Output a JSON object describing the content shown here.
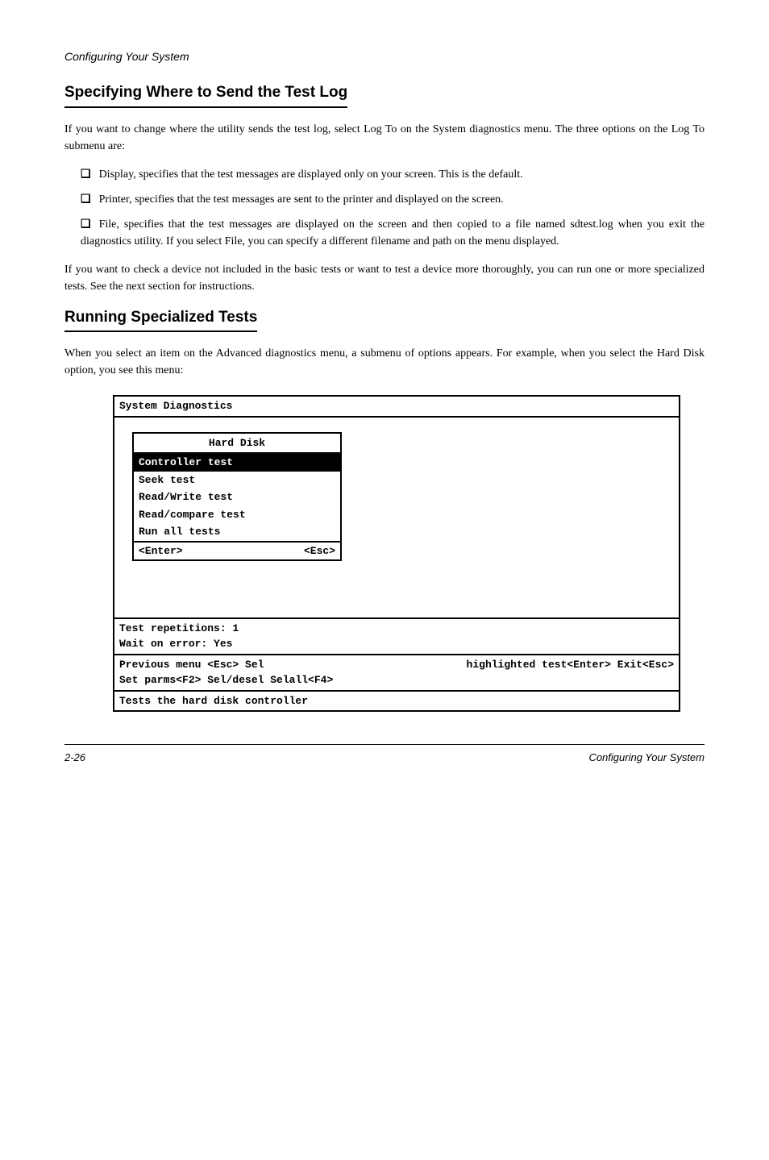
{
  "page_header": "Configuring Your System",
  "section1": {
    "title": "Specifying Where to Send the Test Log",
    "p1": "If you want to change where the utility sends the test log, select Log To on the System diagnostics menu. The three options on the Log To submenu are:",
    "items": [
      {
        "marker": "❑",
        "text": "Display, specifies that the test messages are displayed only on your screen. This is the default."
      },
      {
        "marker": "❑",
        "text": "Printer, specifies that the test messages are sent to the printer and displayed on the screen."
      },
      {
        "marker": "❑",
        "text": "File, specifies that the test messages are displayed on the screen and then copied to a file named sdtest.log when you exit the diagnostics utility. If you select File, you can specify a different filename and path on the menu displayed."
      }
    ],
    "p2": "If you want to check a device not included in the basic tests or want to test a device more thoroughly, you can run one or more specialized tests. See the next section for instructions."
  },
  "section2": {
    "title": "Running Specialized Tests",
    "p1": "When you select an item on the Advanced diagnostics menu, a submenu of options appears. For example, when you select the Hard Disk option, you see this menu:"
  },
  "terminal": {
    "header_line": "System Diagnostics",
    "menu_title": "Hard Disk",
    "menu_items": [
      {
        "label": "Controller test",
        "highlighted": true
      },
      {
        "label": "Seek test",
        "highlighted": false
      },
      {
        "label": "Read/Write test",
        "highlighted": false
      },
      {
        "label": "Read/compare test",
        "highlighted": false
      },
      {
        "label": "Run all tests",
        "highlighted": false
      }
    ],
    "menu_footer_left": "<Enter>",
    "menu_footer_right": "<Esc>",
    "status_line1": "Test repetitions: 1",
    "status_line2": "Wait on error: Yes",
    "keys_line1a": "Previous menu <Esc>   Sel",
    "keys_line1b": "highlighted test<Enter> Exit<Esc>",
    "keys_line2a": "Set parms<F2> Sel/desel             ",
    "keys_line2b": "Selall<F4>",
    "footer_line": "Tests the hard disk controller"
  },
  "bottom": {
    "page_num": "2-26",
    "footer_text": "Configuring Your System"
  }
}
